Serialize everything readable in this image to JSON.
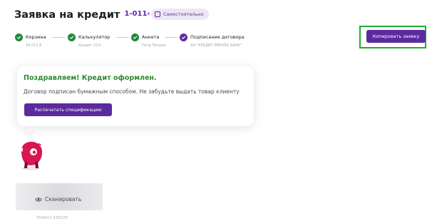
{
  "header": {
    "title": "Заявка на кредит",
    "app_number": "1-011‹",
    "mode_badge": "Самостоятельно"
  },
  "steps": [
    {
      "label": "Корзина",
      "sub": "34 011 ₽",
      "status": "done"
    },
    {
      "label": "Калькулятор",
      "sub": "Кредит 21%",
      "status": "done"
    },
    {
      "label": "Анкета",
      "sub": "Петр Петров",
      "status": "done"
    },
    {
      "label": "Подписание договора",
      "sub": "АО \"КРЕДИТ ЕВРОПА БАНК\"",
      "status": "current"
    }
  ],
  "actions": {
    "copy_label": "Копировать заявку"
  },
  "notice": {
    "title": "Поздравляем! Кредит оформлен.",
    "text": "Договор подписан бумажным способом. Не забудьте выдать товар клиенту",
    "print_label": "Распечатать спецификацию"
  },
  "scan": {
    "label": "Сканировать",
    "code": "YD4013 43022E"
  },
  "colors": {
    "accent": "#5b2a9e",
    "success": "#2d8a2f",
    "step_done": "#1f8a36",
    "step_current": "#5b2a9e",
    "highlight": "#22a834",
    "mascot": "#d8164f"
  },
  "icons": {
    "mode_badge": "edit-icon",
    "step_done": "check-circle-icon",
    "scan": "eye-icon",
    "mascot": "mascot-icon"
  }
}
